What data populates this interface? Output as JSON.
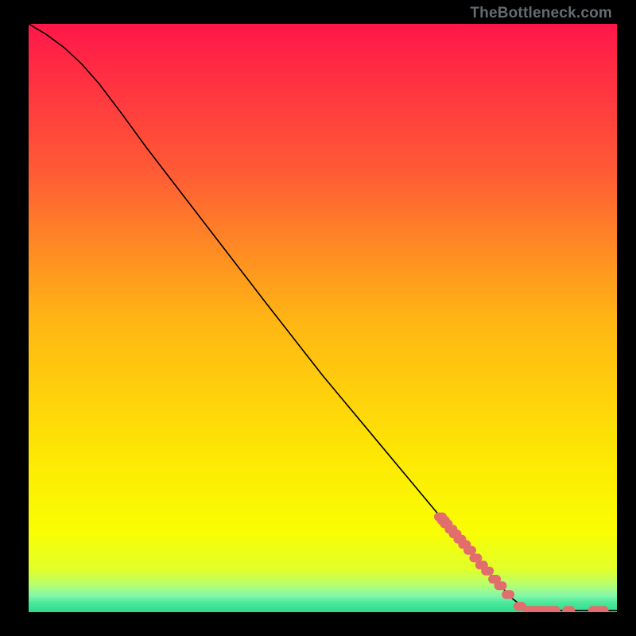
{
  "watermark": "TheBottleneck.com",
  "colors": {
    "black": "#000000",
    "curve": "#000000",
    "marker": "#e26d6d"
  },
  "chart_data": {
    "type": "line",
    "title": "",
    "xlabel": "",
    "ylabel": "",
    "xlim": [
      0,
      100
    ],
    "ylim": [
      0,
      100
    ],
    "grid": false,
    "legend": false,
    "gradient_bands": [
      {
        "y": 0.0,
        "color": "#ff1749"
      },
      {
        "y": 0.25,
        "color": "#ff5b35"
      },
      {
        "y": 0.5,
        "color": "#ffb514"
      },
      {
        "y": 0.745,
        "color": "#fdea03"
      },
      {
        "y": 0.863,
        "color": "#f9fe03"
      },
      {
        "y": 0.926,
        "color": "#e1ff2a"
      },
      {
        "y": 0.952,
        "color": "#b6ff6f"
      },
      {
        "y": 0.97,
        "color": "#85f7a8"
      },
      {
        "y": 0.983,
        "color": "#4ae89c"
      },
      {
        "y": 1.0,
        "color": "#2bd98a"
      }
    ],
    "curve_comment": "x normalized 0..1 across plot width, y is fraction from top (0=top,1=bottom). Curve descends from top-left, slight initial convex bulge, nearly straight diagonal to ~x=0.84, then flat along bottom to x=1.",
    "curve": [
      {
        "x": 0.0,
        "y": 0.0
      },
      {
        "x": 0.03,
        "y": 0.018
      },
      {
        "x": 0.06,
        "y": 0.04
      },
      {
        "x": 0.09,
        "y": 0.068
      },
      {
        "x": 0.12,
        "y": 0.102
      },
      {
        "x": 0.16,
        "y": 0.155
      },
      {
        "x": 0.2,
        "y": 0.21
      },
      {
        "x": 0.3,
        "y": 0.34
      },
      {
        "x": 0.4,
        "y": 0.47
      },
      {
        "x": 0.5,
        "y": 0.598
      },
      {
        "x": 0.6,
        "y": 0.718
      },
      {
        "x": 0.7,
        "y": 0.838
      },
      {
        "x": 0.78,
        "y": 0.93
      },
      {
        "x": 0.82,
        "y": 0.975
      },
      {
        "x": 0.845,
        "y": 0.995
      },
      {
        "x": 0.87,
        "y": 0.997
      },
      {
        "x": 0.92,
        "y": 0.997
      },
      {
        "x": 0.96,
        "y": 0.997
      },
      {
        "x": 1.0,
        "y": 0.997
      }
    ],
    "markers_comment": "Thick salmon dash clusters on the descending limb near the knee and along the floor segment.",
    "markers": [
      {
        "x": 0.7,
        "y": 0.838
      },
      {
        "x": 0.705,
        "y": 0.844
      },
      {
        "x": 0.71,
        "y": 0.85
      },
      {
        "x": 0.718,
        "y": 0.859
      },
      {
        "x": 0.725,
        "y": 0.867
      },
      {
        "x": 0.733,
        "y": 0.876
      },
      {
        "x": 0.741,
        "y": 0.885
      },
      {
        "x": 0.75,
        "y": 0.895
      },
      {
        "x": 0.76,
        "y": 0.908
      },
      {
        "x": 0.77,
        "y": 0.92
      },
      {
        "x": 0.78,
        "y": 0.93
      },
      {
        "x": 0.792,
        "y": 0.944
      },
      {
        "x": 0.802,
        "y": 0.955
      },
      {
        "x": 0.815,
        "y": 0.97
      },
      {
        "x": 0.835,
        "y": 0.99
      },
      {
        "x": 0.852,
        "y": 0.997
      },
      {
        "x": 0.862,
        "y": 0.997
      },
      {
        "x": 0.872,
        "y": 0.997
      },
      {
        "x": 0.882,
        "y": 0.997
      },
      {
        "x": 0.893,
        "y": 0.997
      },
      {
        "x": 0.918,
        "y": 0.997
      },
      {
        "x": 0.962,
        "y": 0.997
      },
      {
        "x": 0.975,
        "y": 0.997
      }
    ]
  }
}
